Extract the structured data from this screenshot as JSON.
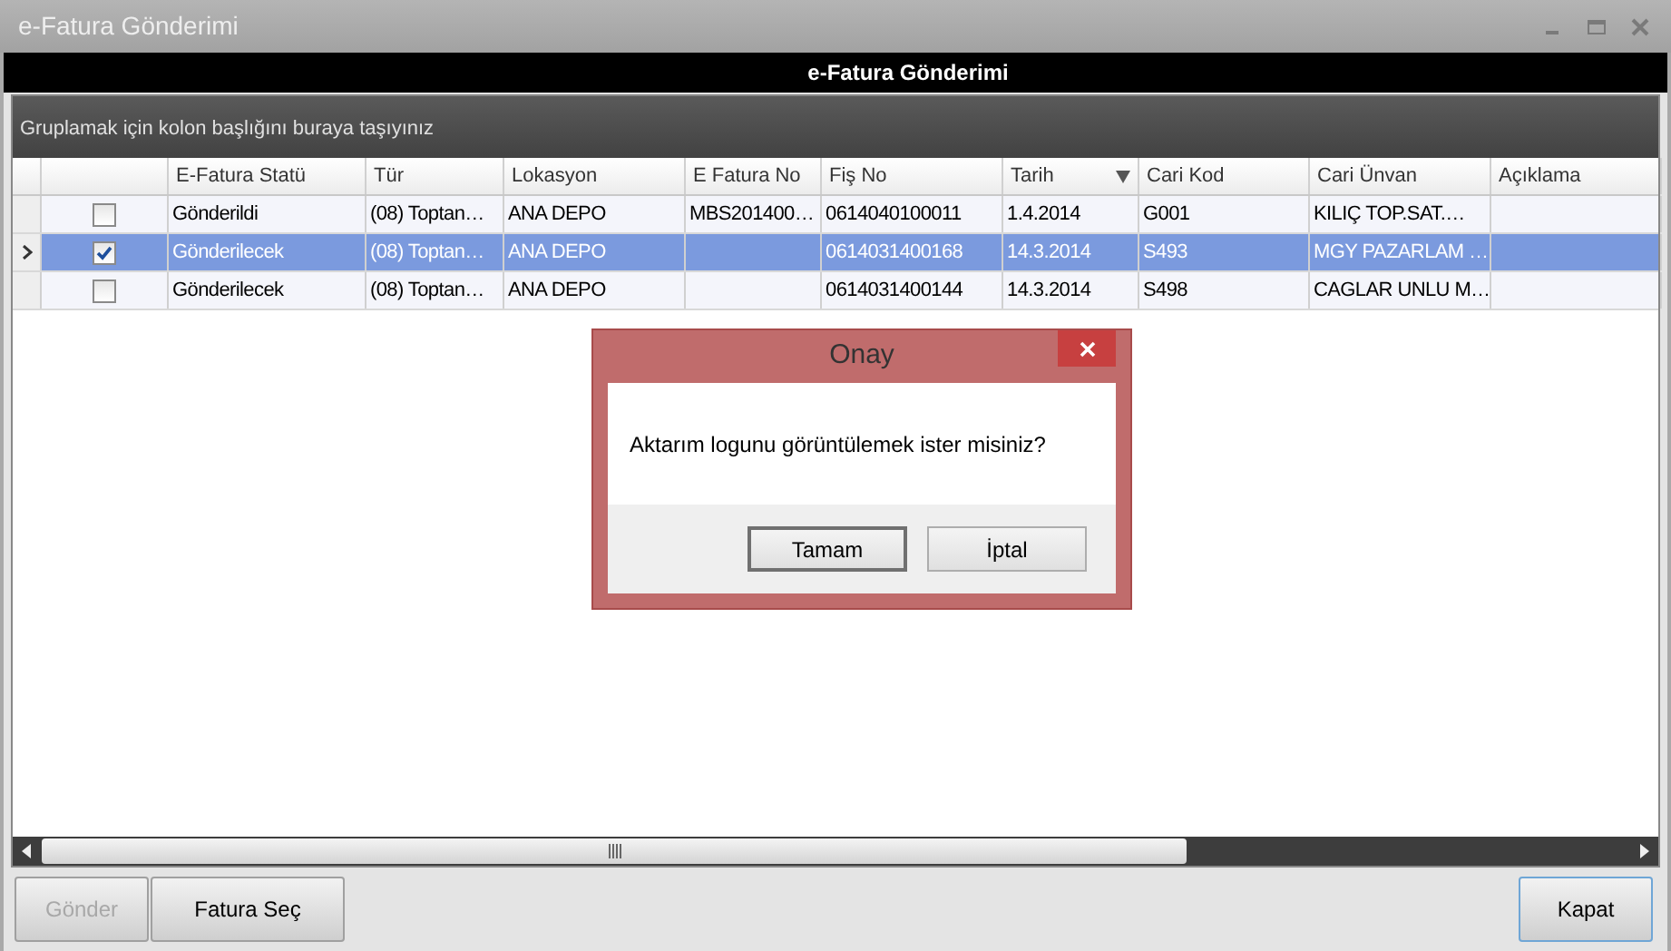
{
  "window": {
    "title": "e-Fatura Gönderimi"
  },
  "header": {
    "title": "e-Fatura Gönderimi"
  },
  "group_panel": {
    "hint": "Gruplamak için kolon başlığını buraya taşıyınız"
  },
  "table": {
    "columns": [
      {
        "label": "E-Fatura Statü",
        "sorted": false
      },
      {
        "label": "Tür",
        "sorted": false
      },
      {
        "label": "Lokasyon",
        "sorted": false
      },
      {
        "label": "E Fatura No",
        "sorted": false
      },
      {
        "label": "Fiş No",
        "sorted": false
      },
      {
        "label": "Tarih",
        "sorted": true
      },
      {
        "label": "Cari Kod",
        "sorted": false
      },
      {
        "label": "Cari Ünvan",
        "sorted": false
      },
      {
        "label": "Açıklama",
        "sorted": false
      }
    ],
    "rows": [
      {
        "selected": false,
        "checked": false,
        "cells": [
          "Gönderildi",
          "(08) Toptan…",
          "ANA DEPO",
          "MBS201400…",
          "0614040100011",
          "1.4.2014",
          "G001",
          "KILIÇ TOP.SAT.…",
          ""
        ]
      },
      {
        "selected": true,
        "checked": true,
        "cells": [
          "Gönderilecek",
          "(08) Toptan…",
          "ANA DEPO",
          "",
          "0614031400168",
          "14.3.2014",
          "S493",
          "MGY PAZARLAM …",
          ""
        ]
      },
      {
        "selected": false,
        "checked": false,
        "cells": [
          "Gönderilecek",
          "(08) Toptan…",
          "ANA DEPO",
          "",
          "0614031400144",
          "14.3.2014",
          "S498",
          "CAGLAR UNLU M…",
          ""
        ]
      }
    ]
  },
  "buttons": [
    {
      "label": "Gönder",
      "disabled": true
    },
    {
      "label": "Fatura Seç",
      "disabled": false
    }
  ],
  "close_button": {
    "label": "Kapat"
  },
  "dialog": {
    "title": "Onay",
    "message": "Aktarım logunu görüntülemek ister misiniz?",
    "buttons": [
      "Tamam",
      "İptal"
    ]
  }
}
